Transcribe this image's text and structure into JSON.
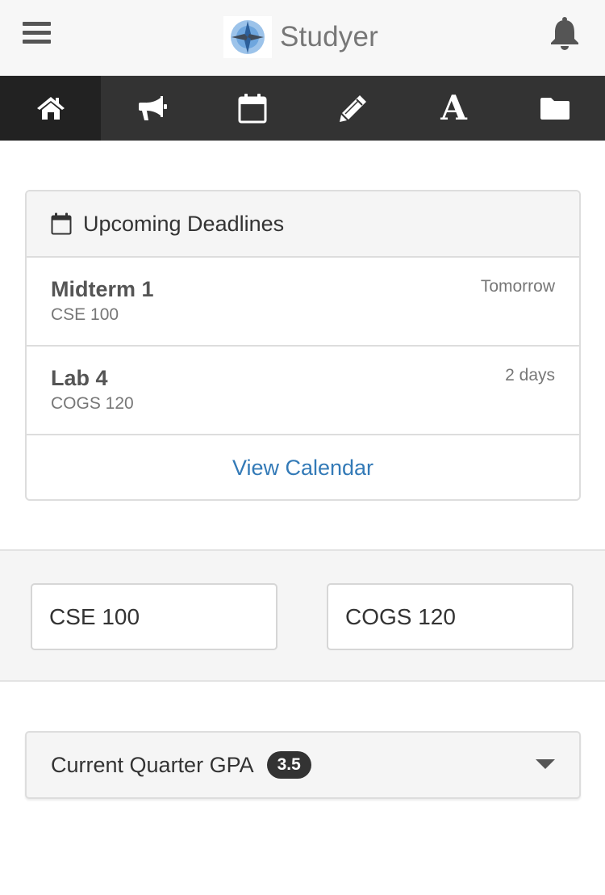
{
  "header": {
    "app_name": "Studyer",
    "menu_icon": "hamburger-icon",
    "logo_icon": "compass-star-logo",
    "notification_icon": "bell-icon"
  },
  "nav": {
    "items": [
      {
        "icon": "home-icon",
        "active": true
      },
      {
        "icon": "megaphone-icon",
        "active": false
      },
      {
        "icon": "calendar-icon",
        "active": false
      },
      {
        "icon": "pencil-icon",
        "active": false
      },
      {
        "icon": "font-icon",
        "glyph": "A",
        "active": false
      },
      {
        "icon": "folder-icon",
        "active": false
      }
    ]
  },
  "deadlines": {
    "title": "Upcoming Deadlines",
    "icon": "calendar-icon",
    "items": [
      {
        "title": "Midterm 1",
        "course": "CSE 100",
        "due": "Tomorrow"
      },
      {
        "title": "Lab 4",
        "course": "COGS 120",
        "due": "2 days"
      }
    ],
    "view_calendar": "View Calendar"
  },
  "courses": [
    "CSE 100",
    "COGS 120"
  ],
  "gpa": {
    "label": "Current Quarter GPA",
    "value": "3.5",
    "caret_icon": "caret-down-icon"
  },
  "colors": {
    "navbar": "#333333",
    "navbar_active": "#222222",
    "link": "#337ab7",
    "panel_header": "#f5f5f5",
    "badge": "#333333"
  }
}
